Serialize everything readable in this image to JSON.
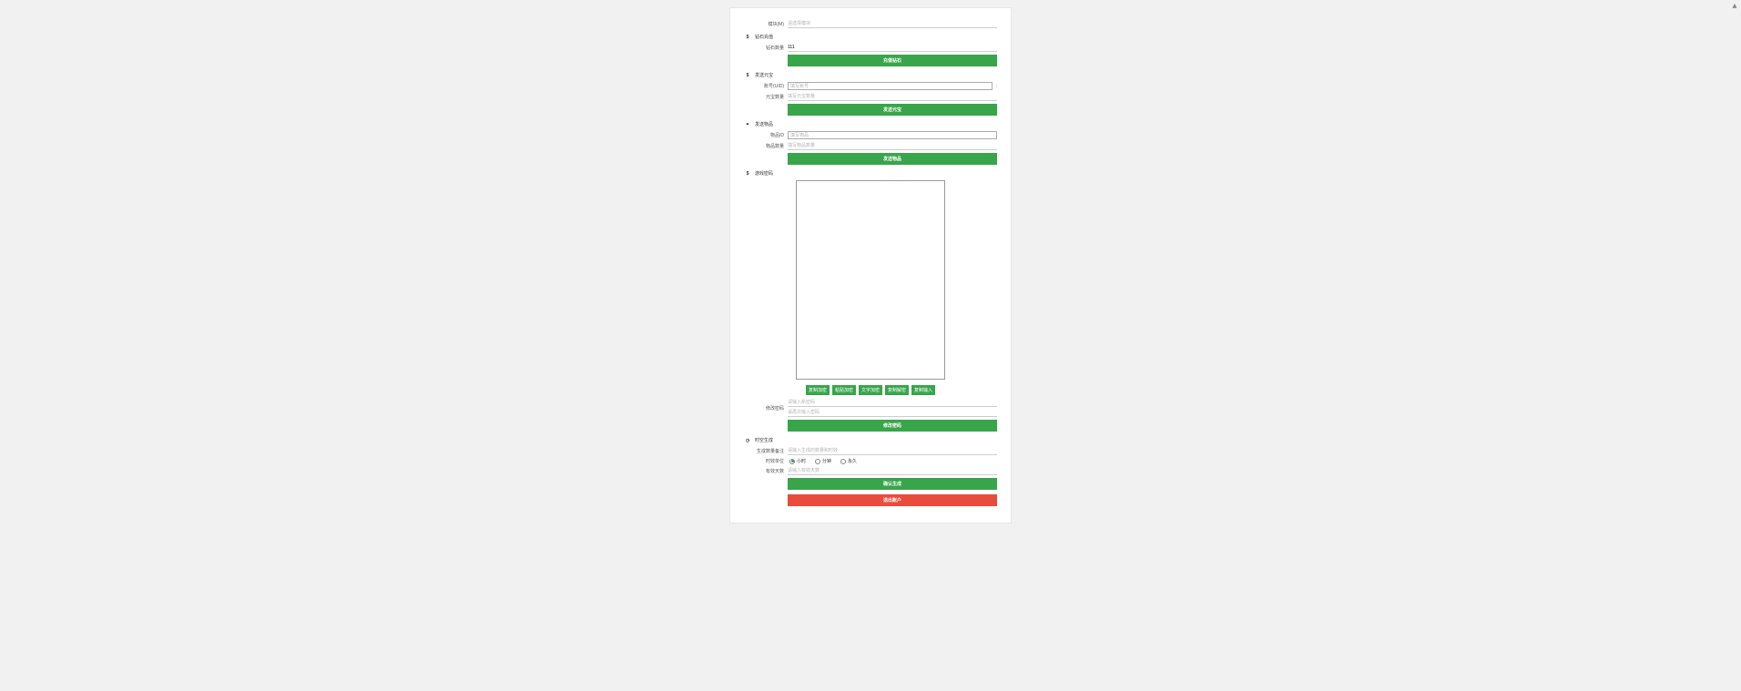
{
  "module_info": {
    "label": "模块(M)",
    "placeholder": "请选择模块"
  },
  "diamond": {
    "title": "钻石充值",
    "amount_label": "钻石数量",
    "amount_value": "111",
    "button": "充值钻石"
  },
  "gold": {
    "title": "发送元宝",
    "account_label": "账号(UID)",
    "account_placeholder": "填写账号",
    "amount_label": "元宝数量",
    "amount_placeholder": "填写元宝数量",
    "button": "发送元宝"
  },
  "item": {
    "title": "发送物品",
    "id_label": "物品ID",
    "id_placeholder": "填写物品",
    "count_label": "物品数量",
    "count_placeholder": "填写物品数量",
    "button": "发送物品"
  },
  "password": {
    "title": "游戏密码",
    "mini_buttons": [
      "复制加密",
      "粘贴加密",
      "文字加密",
      "复制解密",
      "复制输入"
    ],
    "new_pwd_label": "修改密码",
    "new_pwd_placeholder": "请输入新密码",
    "confirm_pwd_placeholder": "请再次输入密码",
    "button": "修改密码"
  },
  "clock": {
    "title": "时空生成",
    "remark_label": "生成数量备注",
    "remark_placeholder": "请输入生成的数量和时效",
    "term_label": "时效单位",
    "term_options": [
      "小时",
      "分钟",
      "永久"
    ],
    "term_selected": 0,
    "days_label": "有效天数",
    "days_placeholder": "请输入有效天数",
    "confirm_button": "确认生成",
    "logout_button": "退出账户"
  }
}
